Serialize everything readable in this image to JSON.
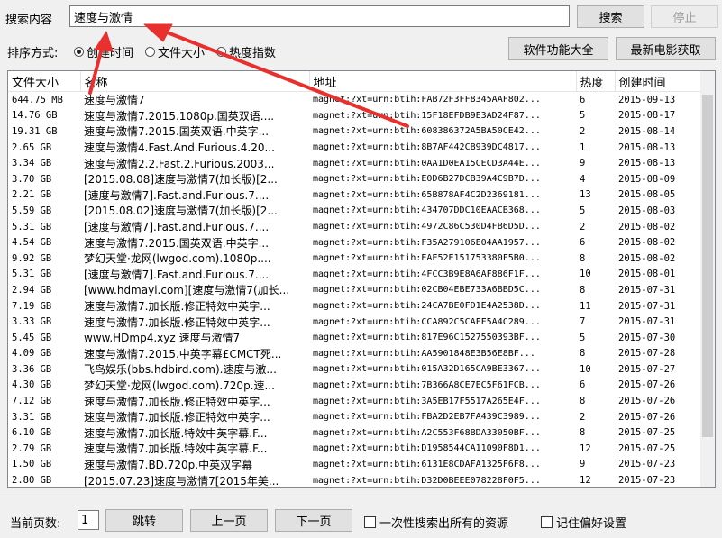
{
  "search": {
    "label": "搜索内容",
    "value": "速度与激情",
    "search_button": "搜索",
    "stop_button": "停止"
  },
  "sort": {
    "label": "排序方式:",
    "options": [
      "创建时间",
      "文件大小",
      "热度指数"
    ],
    "selected": "创建时间"
  },
  "toolbar": {
    "features_button": "软件功能大全",
    "movies_button": "最新电影获取"
  },
  "table": {
    "columns": [
      "文件大小",
      "名称",
      "地址",
      "热度",
      "创建时间"
    ],
    "rows": [
      [
        "644.75 MB",
        "速度与激情7",
        "magnet:?xt=urn:btih:FAB72F3FF8345AAF802...",
        "6",
        "2015-09-13"
      ],
      [
        "14.76 GB",
        "速度与激情7.2015.1080p.国英双语....",
        "magnet:?xt=urn:btih:15F18EFDB9E3AD24F87...",
        "5",
        "2015-08-17"
      ],
      [
        "19.31 GB",
        "速度与激情7.2015.国英双语.中英字...",
        "magnet:?xt=urn:btih:608386372A5BA50CE42...",
        "2",
        "2015-08-14"
      ],
      [
        "2.65 GB",
        "速度与激情4.Fast.And.Furious.4.20...",
        "magnet:?xt=urn:btih:8B7AF442CB939DC4817...",
        "1",
        "2015-08-13"
      ],
      [
        "3.34 GB",
        "速度与激情2.2.Fast.2.Furious.2003...",
        "magnet:?xt=urn:btih:0AA1D0EA15CECD3A44E...",
        "9",
        "2015-08-13"
      ],
      [
        "3.70 GB",
        "[2015.08.08]速度与激情7(加长版)[2...",
        "magnet:?xt=urn:btih:E0D6B27DCB39A4C9B7D...",
        "4",
        "2015-08-09"
      ],
      [
        "2.21 GB",
        "[速度与激情7].Fast.and.Furious.7....",
        "magnet:?xt=urn:btih:65B878AF4C2D2369181...",
        "13",
        "2015-08-05"
      ],
      [
        "5.59 GB",
        "[2015.08.02]速度与激情7(加长版)[2...",
        "magnet:?xt=urn:btih:434707DDC10EAACB368...",
        "5",
        "2015-08-03"
      ],
      [
        "5.31 GB",
        "[速度与激情7].Fast.and.Furious.7....",
        "magnet:?xt=urn:btih:4972C86C530D4FB6D5D...",
        "2",
        "2015-08-02"
      ],
      [
        "4.54 GB",
        "速度与激情7.2015.国英双语.中英字...",
        "magnet:?xt=urn:btih:F35A279106E04AA1957...",
        "6",
        "2015-08-02"
      ],
      [
        "9.92 GB",
        "梦幻天堂·龙网(lwgod.com).1080p....",
        "magnet:?xt=urn:btih:EAE52E151753380F5B0...",
        "8",
        "2015-08-02"
      ],
      [
        "5.31 GB",
        "[速度与激情7].Fast.and.Furious.7....",
        "magnet:?xt=urn:btih:4FCC3B9E8A6AF886F1F...",
        "10",
        "2015-08-01"
      ],
      [
        "2.94 GB",
        "[www.hdmayi.com][速度与激情7(加长...",
        "magnet:?xt=urn:btih:02CB04EBE733A6BBD5C...",
        "8",
        "2015-07-31"
      ],
      [
        "7.19 GB",
        "速度与激情7.加长版.修正特效中英字...",
        "magnet:?xt=urn:btih:24CA7BE0FD1E4A2538D...",
        "11",
        "2015-07-31"
      ],
      [
        "3.33 GB",
        "速度与激情7.加长版.修正特效中英字...",
        "magnet:?xt=urn:btih:CCA892C5CAFF5A4C289...",
        "7",
        "2015-07-31"
      ],
      [
        "5.45 GB",
        "www.HDmp4.xyz 速度与激情7",
        "magnet:?xt=urn:btih:817E96C1527550393BF...",
        "5",
        "2015-07-30"
      ],
      [
        "4.09 GB",
        "速度与激情7.2015.中英字幕£CMCT死...",
        "magnet:?xt=urn:btih:AA5901848E3B56E8BF...",
        "8",
        "2015-07-28"
      ],
      [
        "3.36 GB",
        "飞鸟娱乐(bbs.hdbird.com).速度与激...",
        "magnet:?xt=urn:btih:015A32D165CA9BE3367...",
        "10",
        "2015-07-27"
      ],
      [
        "4.30 GB",
        "梦幻天堂·龙网(lwgod.com).720p.速...",
        "magnet:?xt=urn:btih:7B366A8CE7EC5F61FCB...",
        "6",
        "2015-07-26"
      ],
      [
        "7.12 GB",
        "速度与激情7.加长版.修正特效中英字...",
        "magnet:?xt=urn:btih:3A5EB17F5517A265E4F...",
        "8",
        "2015-07-26"
      ],
      [
        "3.31 GB",
        "速度与激情7.加长版.修正特效中英字...",
        "magnet:?xt=urn:btih:FBA2D2EB7FA439C3989...",
        "2",
        "2015-07-26"
      ],
      [
        "6.10 GB",
        "速度与激情7.加长版.特效中英字幕.F...",
        "magnet:?xt=urn:btih:A2C553F68BDA33050BF...",
        "8",
        "2015-07-25"
      ],
      [
        "2.79 GB",
        "速度与激情7.加长版.特效中英字幕.F...",
        "magnet:?xt=urn:btih:D1958544CA11090F8D1...",
        "12",
        "2015-07-25"
      ],
      [
        "1.50 GB",
        "速度与激情7.BD.720p.中英双字幕",
        "magnet:?xt=urn:btih:6131E8CDAFA1325F6F8...",
        "9",
        "2015-07-23"
      ],
      [
        "2.80 GB",
        "[2015.07.23]速度与激情7[2015年美...",
        "magnet:?xt=urn:btih:D32D0BEEE078228F0F5...",
        "12",
        "2015-07-23"
      ]
    ]
  },
  "pagination": {
    "label": "当前页数:",
    "value": "1",
    "goto_button": "跳转",
    "prev_button": "上一页",
    "next_button": "下一页"
  },
  "options": {
    "search_all": "一次性搜索出所有的资源",
    "remember": "记住偏好设置"
  },
  "colors": {
    "annotation_arrow": "#e8312f"
  }
}
